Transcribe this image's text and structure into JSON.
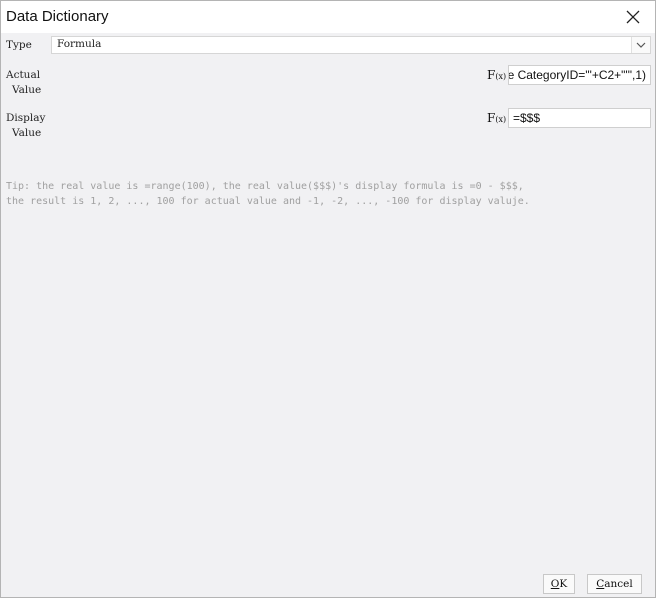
{
  "window": {
    "title": "Data Dictionary"
  },
  "type_row": {
    "label": "Type",
    "selected_value": "Formula"
  },
  "actual_value": {
    "label_line1": "Actual",
    "label_line2": "Value",
    "fx_label": "F",
    "fx_sub": "(x)",
    "input_value": "e CategoryID='\"+C2+\"'\",1)"
  },
  "display_value": {
    "label_line1": "Display",
    "label_line2": "Value",
    "fx_label": "F",
    "fx_sub": "(x)",
    "input_value": "=$$$"
  },
  "tip": {
    "line1": "Tip: the real value is =range(100), the real value($$$)'s display formula is =0 - $$$,",
    "line2": "the result is 1, 2, ..., 100 for actual value and -1, -2, ..., -100 for display valuje."
  },
  "buttons": {
    "ok_accel": "O",
    "ok_rest": "K",
    "cancel_accel": "C",
    "cancel_rest": "ancel"
  },
  "colors": {
    "background": "#f1f1f3",
    "titlebar": "#ffffff",
    "tip_text": "#a0a0a0"
  }
}
